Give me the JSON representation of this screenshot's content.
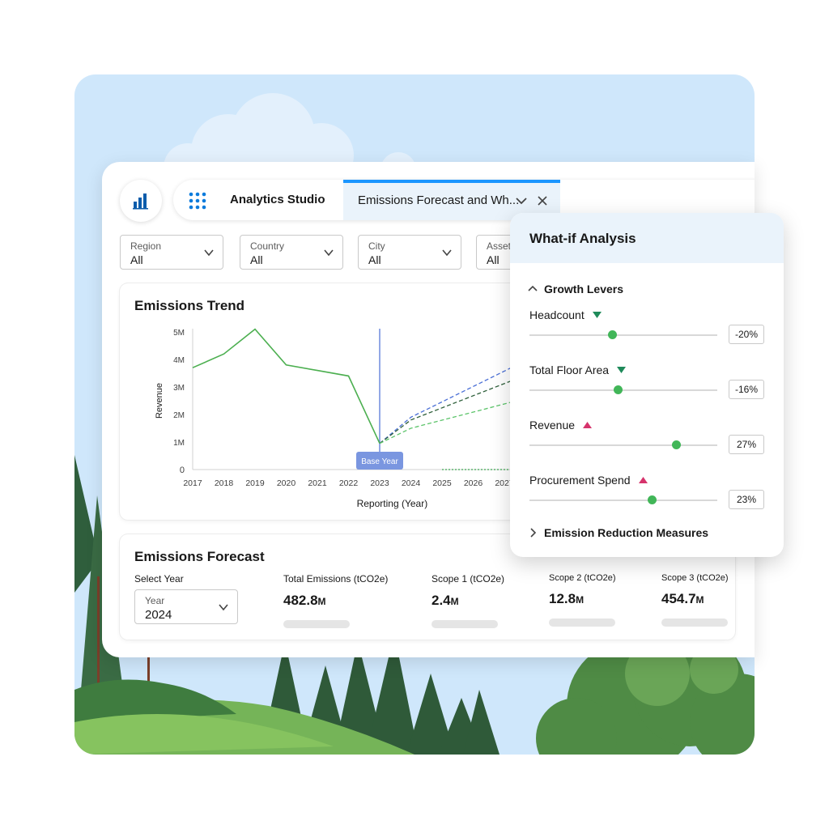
{
  "navbar": {
    "app_name": "Analytics Studio",
    "active_tab": "Emissions Forecast and Wh..."
  },
  "filters": [
    {
      "label": "Region",
      "value": "All"
    },
    {
      "label": "Country",
      "value": "All"
    },
    {
      "label": "City",
      "value": "All"
    },
    {
      "label": "Asset",
      "value": "All"
    }
  ],
  "trend": {
    "title": "Emissions Trend",
    "base_year_label": "Base Year"
  },
  "chart_data": {
    "type": "line",
    "title": "Emissions Trend",
    "xlabel": "Reporting (Year)",
    "ylabel": "Revenue",
    "x": [
      "2017",
      "2018",
      "2019",
      "2020",
      "2021",
      "2022",
      "2023",
      "2024",
      "2025",
      "2026",
      "2027"
    ],
    "y_ticks": [
      "0",
      "1M",
      "2M",
      "3M",
      "4M",
      "5M"
    ],
    "ylim": [
      0,
      5000000
    ],
    "series": [
      {
        "style": "solid",
        "color": "#4caf50",
        "x": [
          2017,
          2018,
          2019,
          2020,
          2021,
          2022,
          2023
        ],
        "y": [
          3700000,
          4200000,
          5100000,
          3800000,
          3600000,
          3400000,
          950000
        ]
      },
      {
        "style": "dashed",
        "color": "#4a6fd6",
        "x": [
          2023,
          2024,
          2027.4
        ],
        "y": [
          950000,
          1900000,
          3800000
        ]
      },
      {
        "style": "dashed",
        "color": "#2e5f3a",
        "x": [
          2023,
          2024,
          2027.4
        ],
        "y": [
          950000,
          1800000,
          3300000
        ]
      },
      {
        "style": "dashed",
        "color": "#5cc46a",
        "x": [
          2023,
          2024,
          2027.4
        ],
        "y": [
          950000,
          1500000,
          2500000
        ]
      },
      {
        "style": "dotted",
        "color": "#3aa84f",
        "x": [
          2025,
          2027.4
        ],
        "y": [
          0,
          0
        ]
      }
    ],
    "annotations": [
      {
        "x": 2023,
        "label": "Base Year"
      }
    ],
    "grid": false,
    "legend": "none"
  },
  "forecast": {
    "title": "Emissions Forecast",
    "select_label": "Select Year",
    "year_field_label": "Year",
    "year_value": "2024",
    "metrics": [
      {
        "label": "Total Emissions (tCO2e)",
        "value": "482.8",
        "unit": "M"
      },
      {
        "label": "Scope 1 (tCO2e)",
        "value": "2.4",
        "unit": "M"
      },
      {
        "label": "Scope 2 (tCO2e)",
        "value": "12.8",
        "unit": "M"
      },
      {
        "label": "Scope 3 (tCO2e)",
        "value": "454.7",
        "unit": "M"
      }
    ]
  },
  "whatif": {
    "title": "What-if Analysis",
    "growth_section": "Growth Levers",
    "reduction_section": "Emission Reduction Measures",
    "levers": [
      {
        "name": "Headcount",
        "direction": "down",
        "value": "-20%",
        "level": 0.44
      },
      {
        "name": "Total Floor Area",
        "direction": "down",
        "value": "-16%",
        "level": 0.47
      },
      {
        "name": "Revenue",
        "direction": "up",
        "value": "27%",
        "level": 0.78
      },
      {
        "name": "Procurement Spend",
        "direction": "up",
        "value": "23%",
        "level": 0.65
      }
    ]
  },
  "colors": {
    "accent": "#1b96ff",
    "down_arrow": "#1f8a5a",
    "up_arrow": "#d6336c",
    "slider_thumb": "#41b658"
  }
}
